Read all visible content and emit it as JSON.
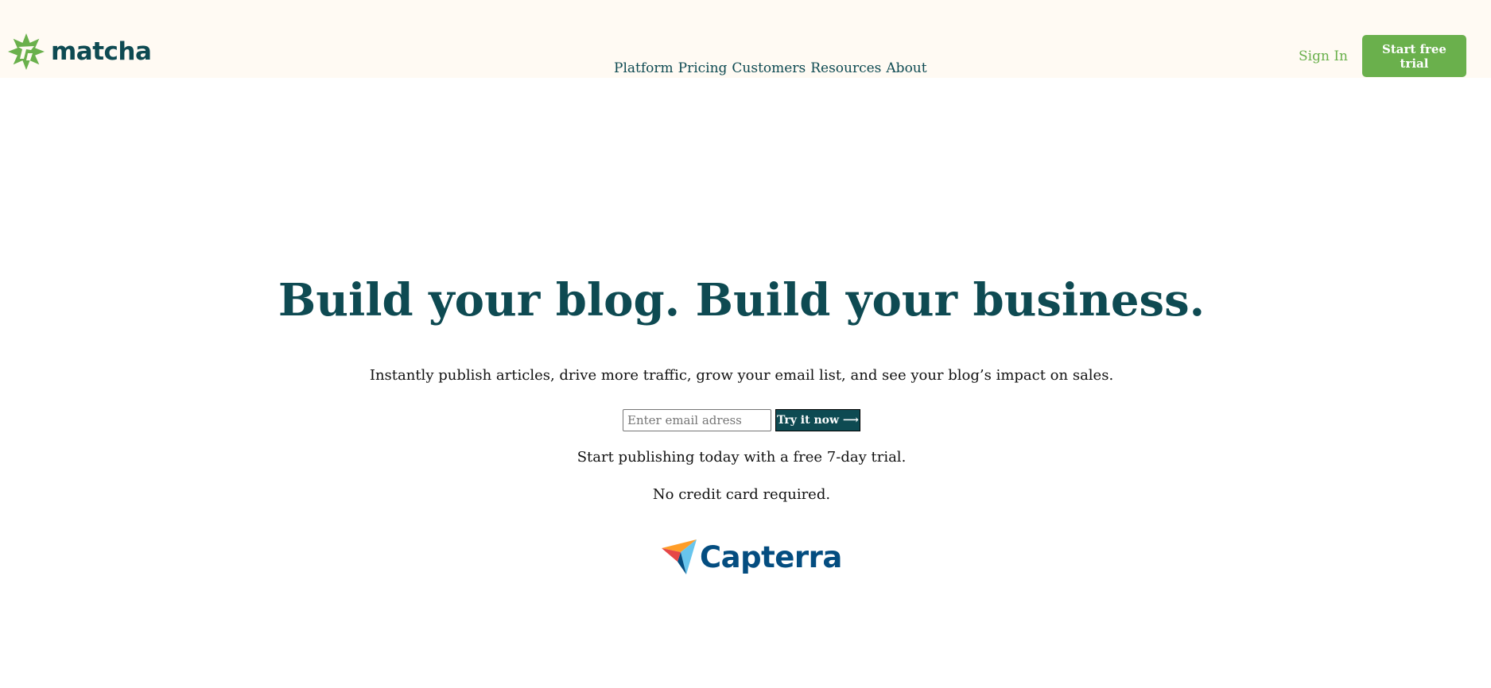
{
  "brand": {
    "name": "matcha",
    "primary_color": "#0e4a52",
    "accent_color": "#6ab04c",
    "header_bg": "#fffaf3",
    "logo_icon": "matcha-star-icon"
  },
  "nav": {
    "items": [
      {
        "label": "Platform"
      },
      {
        "label": "Pricing"
      },
      {
        "label": "Customers"
      },
      {
        "label": "Resources"
      },
      {
        "label": "About"
      }
    ]
  },
  "header_actions": {
    "sign_in": "Sign In",
    "start_trial": "Start free trial"
  },
  "hero": {
    "title": "Build your blog. Build your business.",
    "subtitle": "Instantly publish articles, drive more traffic, grow your email list, and see your blog’s impact on sales.",
    "email_placeholder": "Enter email adress",
    "email_value": "",
    "cta": "Try it now ⟶",
    "trial_note": "Start publishing today with a free 7-day trial.",
    "card_note": "No credit card required."
  },
  "review_badge": {
    "name": "Capterra",
    "color": "#044d80",
    "icon": "capterra-arrow-icon"
  }
}
